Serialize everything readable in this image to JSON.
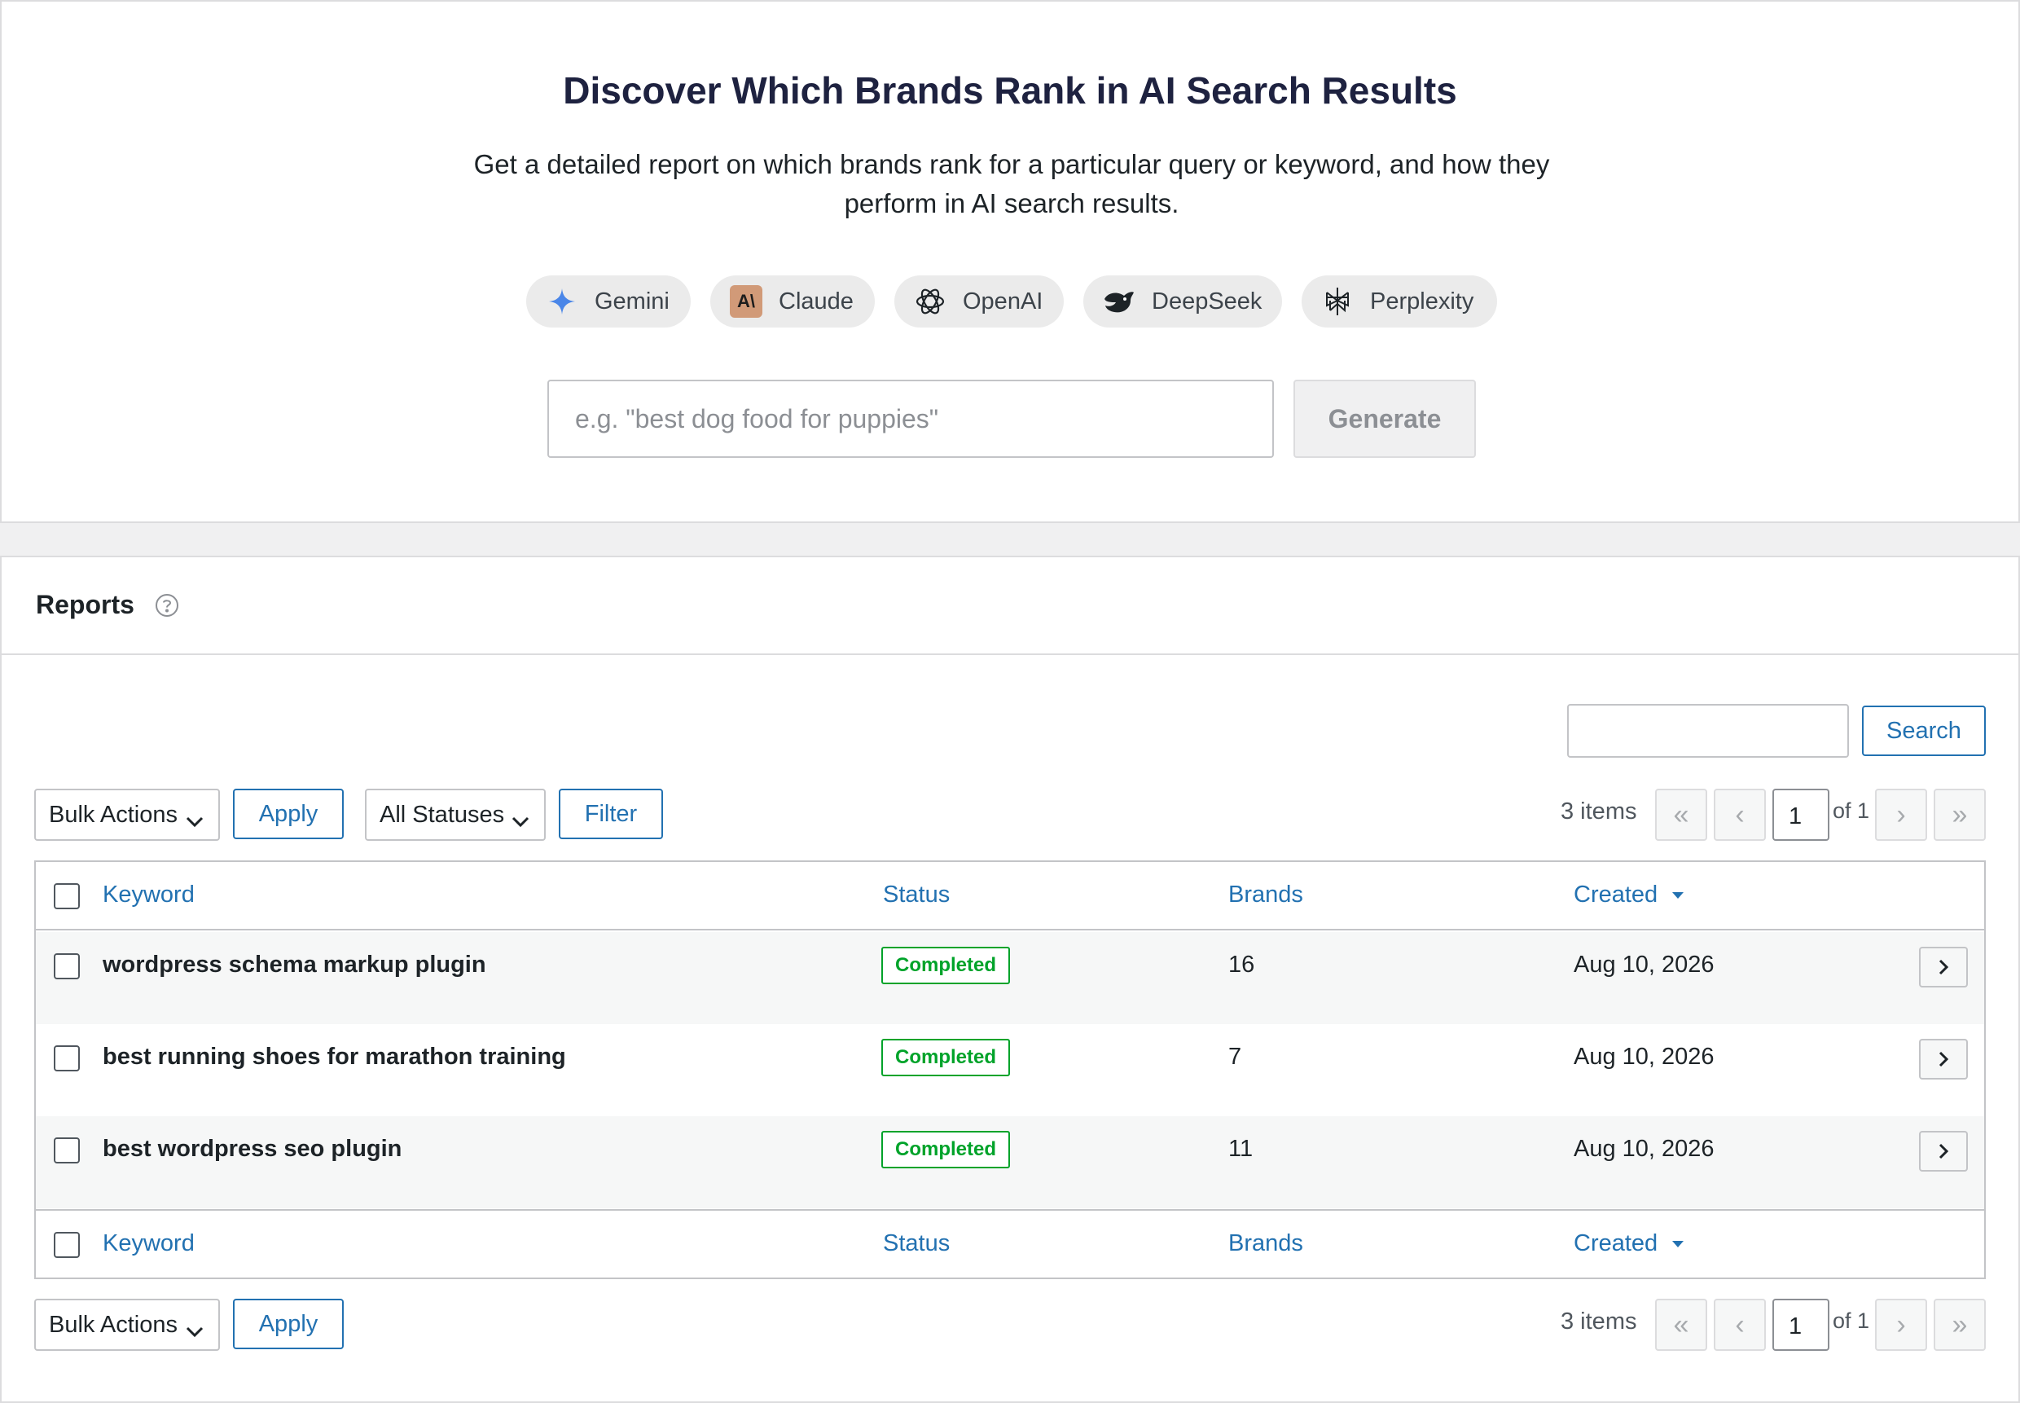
{
  "hero": {
    "title": "Discover Which Brands Rank in AI Search Results",
    "subtitle": "Get a detailed report on which brands rank for a particular query or keyword, and how they perform in AI search results.",
    "engines": [
      {
        "label": "Gemini",
        "icon": "gemini-icon"
      },
      {
        "label": "Claude",
        "icon": "claude-icon",
        "icon_text": "A\\"
      },
      {
        "label": "OpenAI",
        "icon": "openai-icon"
      },
      {
        "label": "DeepSeek",
        "icon": "deepseek-icon"
      },
      {
        "label": "Perplexity",
        "icon": "perplexity-icon"
      }
    ],
    "input_placeholder": "e.g. \"best dog food for puppies\"",
    "generate_label": "Generate"
  },
  "reports": {
    "title": "Reports",
    "search_label": "Search",
    "bulk_actions": "Bulk Actions",
    "apply": "Apply",
    "statuses": "All Statuses",
    "filter": "Filter",
    "items_count": "3 items",
    "page": "1",
    "of_pages": "of 1",
    "pagination": {
      "first": "«",
      "prev": "‹",
      "next": "›",
      "last": "»"
    },
    "columns": {
      "keyword": "Keyword",
      "status": "Status",
      "brands": "Brands",
      "created": "Created"
    },
    "rows": [
      {
        "keyword": "wordpress schema markup plugin",
        "status": "Completed",
        "brands": "16",
        "created": "Aug 10, 2026"
      },
      {
        "keyword": "best running shoes for marathon training",
        "status": "Completed",
        "brands": "7",
        "created": "Aug 10, 2026"
      },
      {
        "keyword": "best wordpress seo plugin",
        "status": "Completed",
        "brands": "11",
        "created": "Aug 10, 2026"
      }
    ]
  },
  "colors": {
    "accent": "#2271b1",
    "status_completed": "#00a32a",
    "title": "#1e2240"
  }
}
